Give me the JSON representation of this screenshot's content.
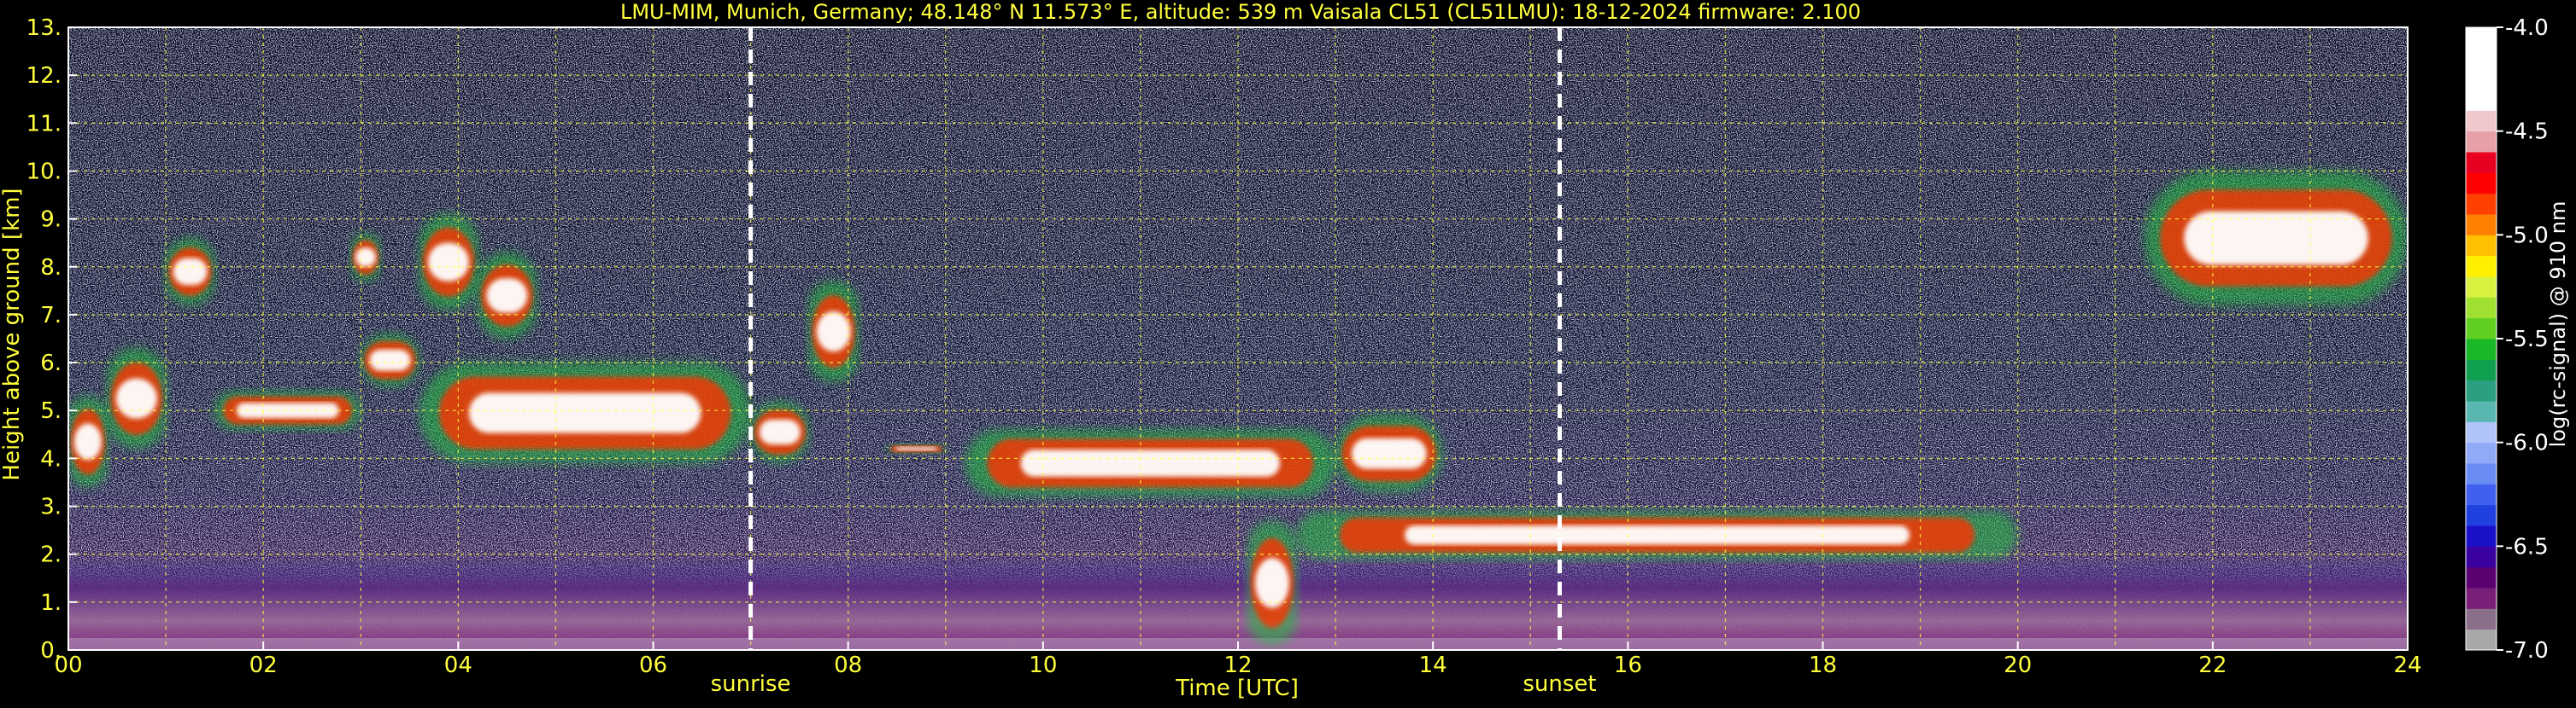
{
  "chart_data": {
    "type": "heatmap",
    "title": "LMU-MIM, Munich, Germany; 48.148° N 11.573° E, altitude: 539 m    Vaisala CL51 (CL51LMU): 18-12-2024    firmware: 2.100",
    "xlabel": "Time [UTC]",
    "ylabel": "Height above ground [km]",
    "xlim": [
      0,
      24
    ],
    "ylim": [
      0,
      13
    ],
    "x_ticks": [
      "00",
      "02",
      "04",
      "06",
      "08",
      "10",
      "12",
      "14",
      "16",
      "18",
      "20",
      "22",
      "24"
    ],
    "y_ticks": [
      "0.",
      "1.",
      "2.",
      "3.",
      "4.",
      "5.",
      "6.",
      "7.",
      "8.",
      "9.",
      "10.",
      "11.",
      "12.",
      "13."
    ],
    "grid": true,
    "markers": [
      {
        "label": "sunrise",
        "time": 7.0
      },
      {
        "label": "sunset",
        "time": 15.3
      }
    ],
    "colorbar": {
      "label": "log(rc-signal) @ 910 nm",
      "range": [
        -7.0,
        -4.0
      ],
      "ticks": [
        "-4.0",
        "-4.5",
        "-5.0",
        "-5.5",
        "-6.0",
        "-6.5",
        "-7.0"
      ],
      "colors": [
        "#a8a8a8",
        "#8a6f8a",
        "#7a1f78",
        "#5a0070",
        "#3a00a0",
        "#1a10c8",
        "#2040e0",
        "#4060f0",
        "#6a8cf5",
        "#90aaf8",
        "#b0c4fa",
        "#58b8b0",
        "#2aa080",
        "#10a050",
        "#18b828",
        "#60d020",
        "#a0e030",
        "#d8f040",
        "#fff000",
        "#ffc000",
        "#ff8000",
        "#ff4000",
        "#ff0000",
        "#e80020",
        "#e8a0a8",
        "#f0c8cc",
        "#ffffff",
        "#ffffff",
        "#ffffff",
        "#ffffff"
      ]
    },
    "features": [
      {
        "kind": "cloud",
        "start": 0.0,
        "end": 0.4,
        "base": 3.4,
        "top": 5.3
      },
      {
        "kind": "cloud",
        "start": 0.4,
        "end": 1.0,
        "base": 4.2,
        "top": 6.3
      },
      {
        "kind": "cloud",
        "start": 1.0,
        "end": 1.5,
        "base": 7.2,
        "top": 8.6
      },
      {
        "kind": "cloud",
        "start": 1.5,
        "end": 3.0,
        "base": 4.6,
        "top": 5.4
      },
      {
        "kind": "cloud",
        "start": 2.9,
        "end": 3.2,
        "base": 7.7,
        "top": 8.7
      },
      {
        "kind": "cloud",
        "start": 3.0,
        "end": 3.6,
        "base": 5.5,
        "top": 6.6
      },
      {
        "kind": "cloud",
        "start": 3.6,
        "end": 4.2,
        "base": 7.1,
        "top": 9.1
      },
      {
        "kind": "cloud",
        "start": 3.6,
        "end": 7.0,
        "base": 3.9,
        "top": 6.0
      },
      {
        "kind": "cloud",
        "start": 4.2,
        "end": 4.8,
        "base": 6.5,
        "top": 8.3
      },
      {
        "kind": "cloud",
        "start": 7.0,
        "end": 7.6,
        "base": 3.9,
        "top": 5.2
      },
      {
        "kind": "cloud",
        "start": 7.6,
        "end": 8.1,
        "base": 5.6,
        "top": 7.7
      },
      {
        "kind": "cloud",
        "start": 8.4,
        "end": 9.0,
        "base": 4.1,
        "top": 4.3
      },
      {
        "kind": "cloud",
        "start": 9.2,
        "end": 13.0,
        "base": 3.2,
        "top": 4.6
      },
      {
        "kind": "cloud",
        "start": 12.1,
        "end": 12.6,
        "base": 0.1,
        "top": 2.7
      },
      {
        "kind": "cloud",
        "start": 13.0,
        "end": 14.1,
        "base": 3.3,
        "top": 4.9
      },
      {
        "kind": "cloud",
        "start": 12.6,
        "end": 20.0,
        "base": 1.9,
        "top": 2.9
      },
      {
        "kind": "cloud",
        "start": 21.3,
        "end": 24.0,
        "base": 7.2,
        "top": 10.0
      },
      {
        "kind": "aerosol_layer",
        "start": 0.0,
        "end": 24.0,
        "base": 0.0,
        "top": 2.0
      }
    ]
  }
}
